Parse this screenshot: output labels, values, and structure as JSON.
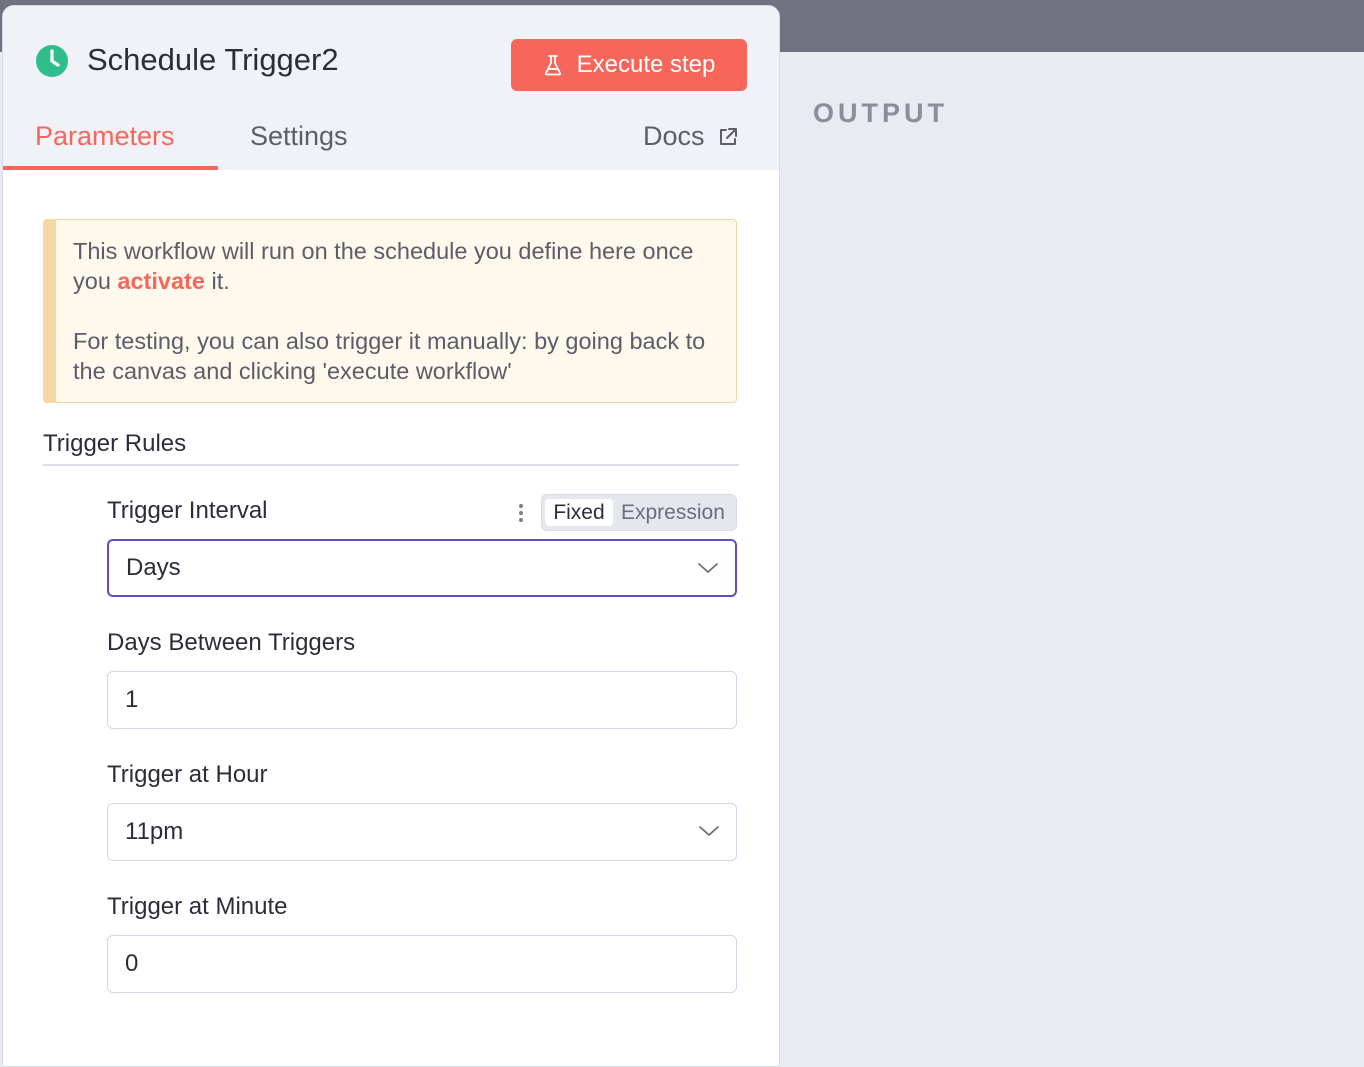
{
  "node": {
    "title": "Schedule Trigger2",
    "icon": "clock-icon",
    "execute_label": "Execute step"
  },
  "tabs": [
    {
      "label": "Parameters",
      "active": true
    },
    {
      "label": "Settings",
      "active": false
    }
  ],
  "docs_label": "Docs",
  "notice": {
    "line1_before": "This workflow will run on the schedule you define here once you ",
    "line1_link": "activate",
    "line1_after": " it.",
    "line2": "For testing, you can also trigger it manually: by going back to the canvas and clicking 'execute workflow'"
  },
  "section": {
    "title": "Trigger Rules"
  },
  "fields": {
    "trigger_interval": {
      "label": "Trigger Interval",
      "value": "Days",
      "mode_fixed": "Fixed",
      "mode_expression": "Expression"
    },
    "days_between": {
      "label": "Days Between Triggers",
      "value": "1"
    },
    "trigger_hour": {
      "label": "Trigger at Hour",
      "value": "11pm"
    },
    "trigger_minute": {
      "label": "Trigger at Minute",
      "value": "0"
    }
  },
  "output": {
    "title": "OUTPUT"
  },
  "colors": {
    "accent": "#f7665b",
    "clock_icon": "#2fbd8c",
    "focus_border": "#5a4fc4",
    "notice_bg": "#fef8ed",
    "notice_border": "#f4d6a2"
  }
}
